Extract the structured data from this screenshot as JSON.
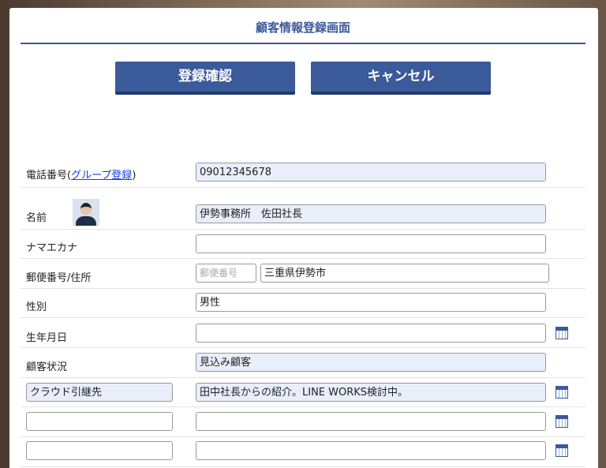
{
  "page": {
    "title": "顧客情報登録画面"
  },
  "buttons": {
    "confirm": "登録確認",
    "cancel": "キャンセル"
  },
  "fields": {
    "phone": {
      "label_prefix": "電話番号(",
      "label_link": "グループ登録",
      "label_suffix": ")",
      "value": "09012345678"
    },
    "name": {
      "label": "名前",
      "value": "伊勢事務所　佐田社長"
    },
    "kana": {
      "label": "ナマエカナ",
      "value": ""
    },
    "address": {
      "label": "郵便番号/住所",
      "zip_placeholder": "郵便番号",
      "value": "三重県伊勢市"
    },
    "gender": {
      "label": "性別",
      "value": "男性"
    },
    "birthdate": {
      "label": "生年月日",
      "value": ""
    },
    "status": {
      "label": "顧客状況",
      "value": "見込み顧客"
    },
    "custom1": {
      "label": "クラウド引継先",
      "value": "田中社長からの紹介。LINE WORKS検討中。"
    },
    "custom2": {
      "label": "",
      "value": ""
    },
    "custom3": {
      "label": "",
      "value": ""
    }
  },
  "icons": {
    "calendar": "calendar-icon",
    "avatar": "avatar"
  },
  "colors": {
    "accent": "#3b5a9a",
    "filled_bg": "#e8eefa",
    "link": "#1a3ee0"
  }
}
